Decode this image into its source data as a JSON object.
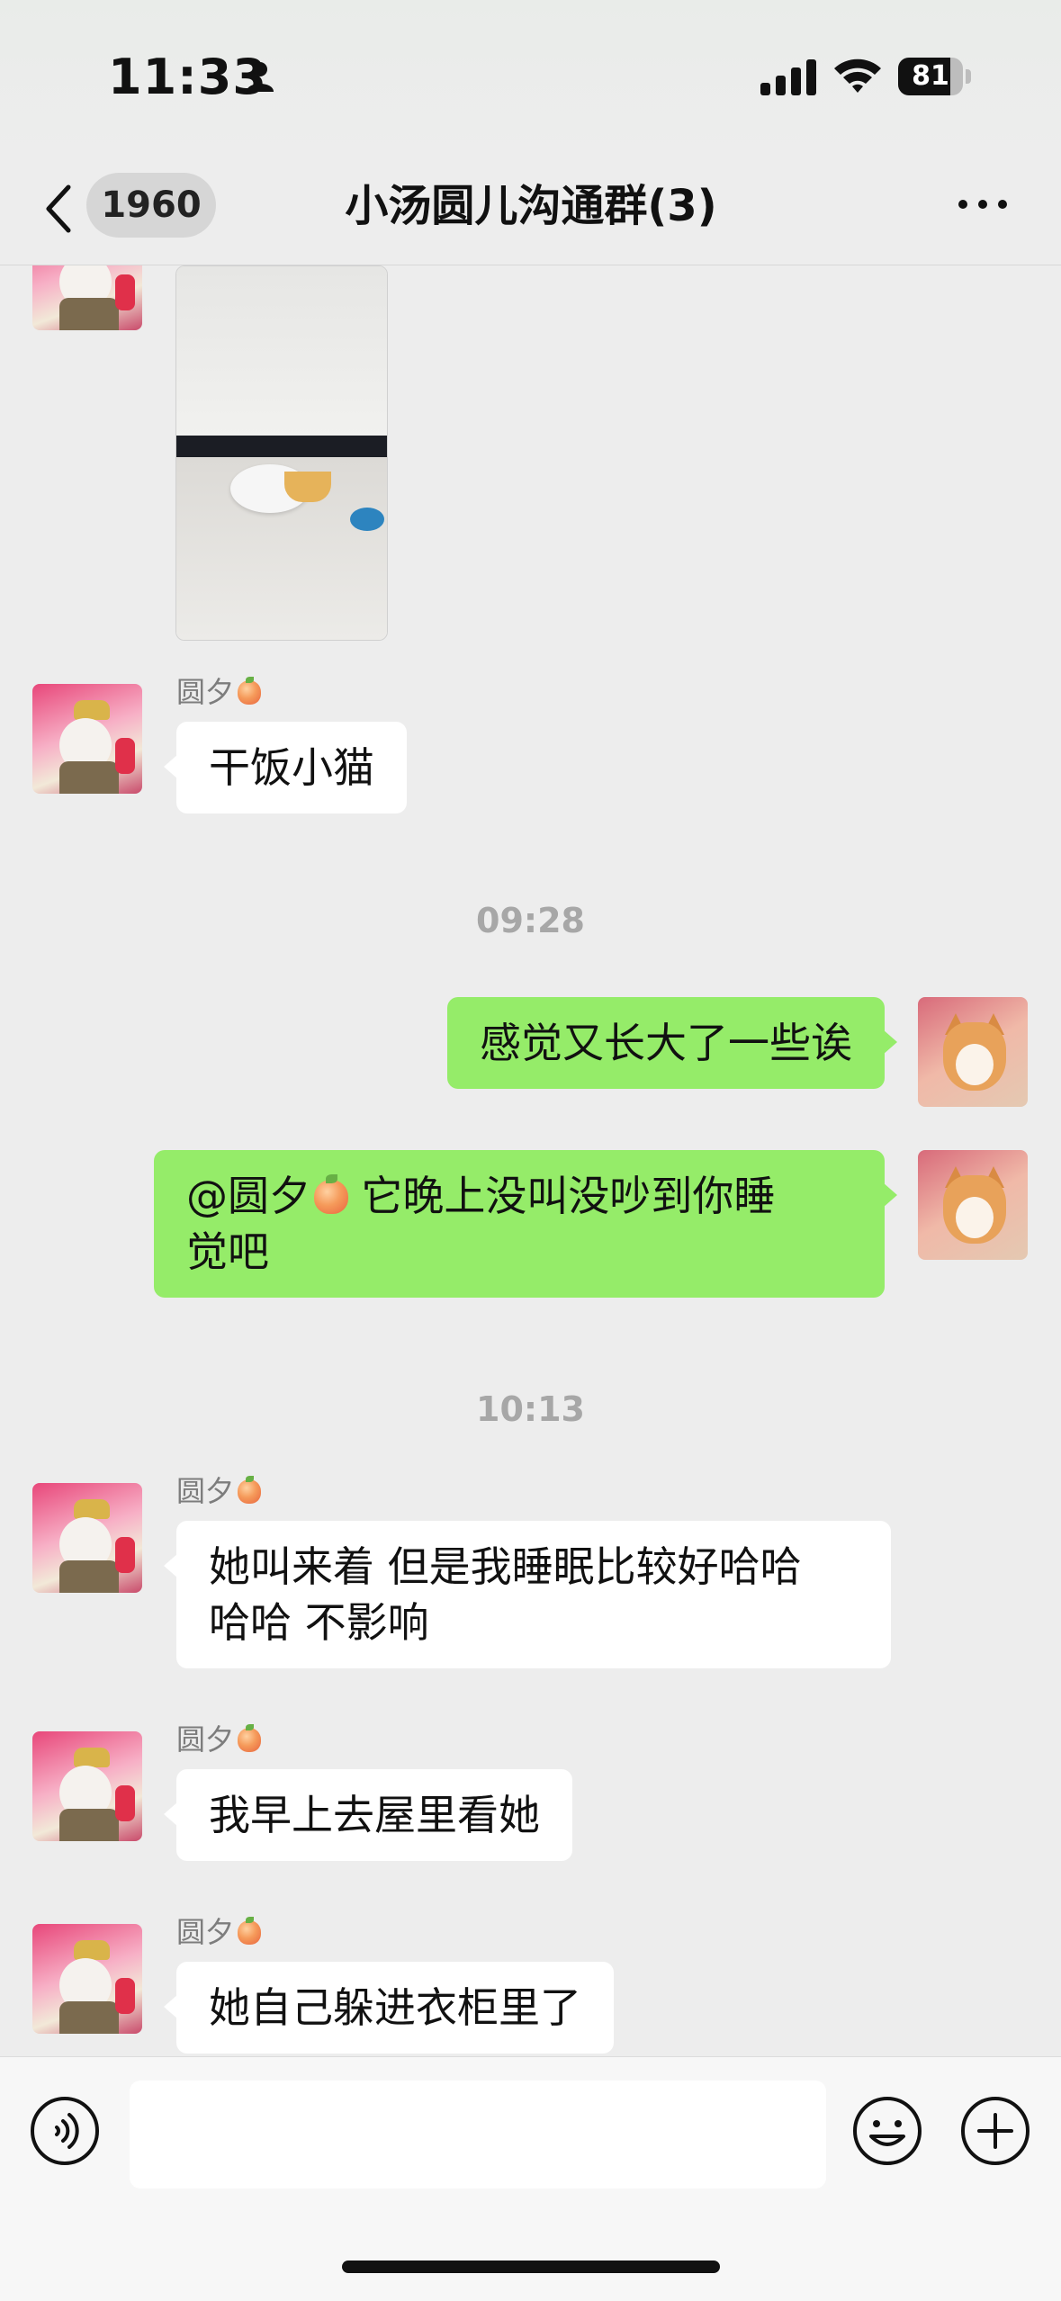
{
  "status_bar": {
    "time": "11:33",
    "battery": "81",
    "battery_level": 0.81,
    "icons": [
      "person-icon",
      "signal-icon",
      "wifi-icon",
      "battery-icon"
    ]
  },
  "nav": {
    "back_count": "1960",
    "title": "小汤圆儿沟通群(3)",
    "icons": [
      "back-chevron-icon",
      "more-dots-icon"
    ]
  },
  "messages": [
    {
      "type": "image",
      "sender": "",
      "content": "cat-eating-photo",
      "side": "left"
    },
    {
      "type": "text",
      "sender": "圆夕",
      "text": "干饭小猫",
      "side": "left"
    },
    {
      "type": "time",
      "text": "09:28"
    },
    {
      "type": "text",
      "text": "感觉又长大了一些诶",
      "side": "right"
    },
    {
      "type": "text",
      "text_before": "@圆夕",
      "text_after": " 它晚上没叫没吵到你睡",
      "text_line2": "觉吧",
      "side": "right"
    },
    {
      "type": "time",
      "text": "10:13"
    },
    {
      "type": "text",
      "sender": "圆夕",
      "text_line1": "她叫来着 但是我睡眠比较好哈哈",
      "text_line2": "哈哈 不影响",
      "side": "left"
    },
    {
      "type": "text",
      "sender": "圆夕",
      "text": "我早上去屋里看她",
      "side": "left"
    },
    {
      "type": "text",
      "sender": "圆夕",
      "text": "她自己躲进衣柜里了",
      "side": "left"
    }
  ],
  "input_bar": {
    "value": "",
    "icons": [
      "voice-icon",
      "emoji-icon",
      "plus-icon"
    ]
  },
  "colors": {
    "background": "#ededed",
    "bubble_out": "#95ec69",
    "bubble_in": "#ffffff"
  }
}
